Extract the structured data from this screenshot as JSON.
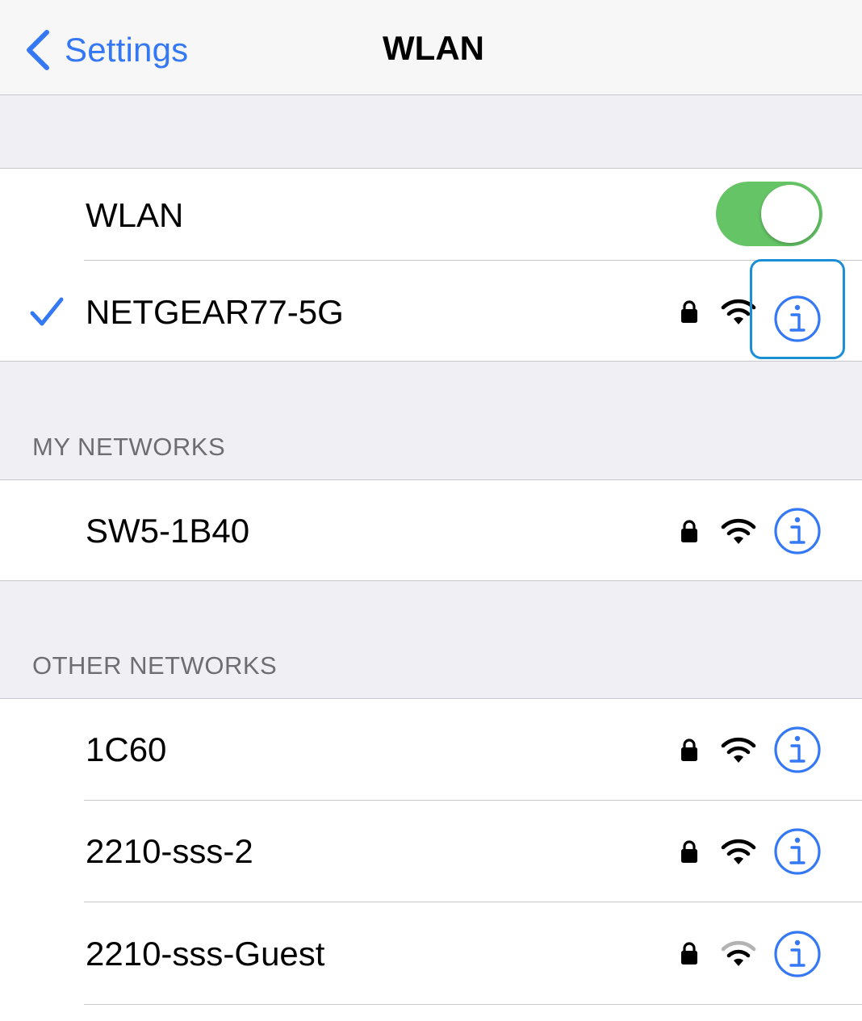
{
  "navbar": {
    "back_label": "Settings",
    "title": "WLAN"
  },
  "wlan_toggle": {
    "label": "WLAN",
    "on": true
  },
  "connected": {
    "name": "NETGEAR77-5G",
    "locked": true,
    "signal": "full",
    "selected": true
  },
  "my_networks": {
    "header": "MY NETWORKS",
    "items": [
      {
        "name": "SW5-1B40",
        "locked": true,
        "signal": "full"
      }
    ]
  },
  "other_networks": {
    "header": "OTHER NETWORKS",
    "items": [
      {
        "name": "1C60",
        "locked": true,
        "signal": "full"
      },
      {
        "name": "2210-sss-2",
        "locked": true,
        "signal": "full"
      },
      {
        "name": "2210-sss-Guest",
        "locked": true,
        "signal": "weak"
      }
    ]
  },
  "colors": {
    "accent": "#3478f6",
    "toggle_on": "#65c466",
    "highlight": "#1a8fd6",
    "background": "#efeff4"
  },
  "icons": [
    "chevron-left-icon",
    "checkmark-icon",
    "lock-icon",
    "wifi-icon",
    "info-icon"
  ]
}
